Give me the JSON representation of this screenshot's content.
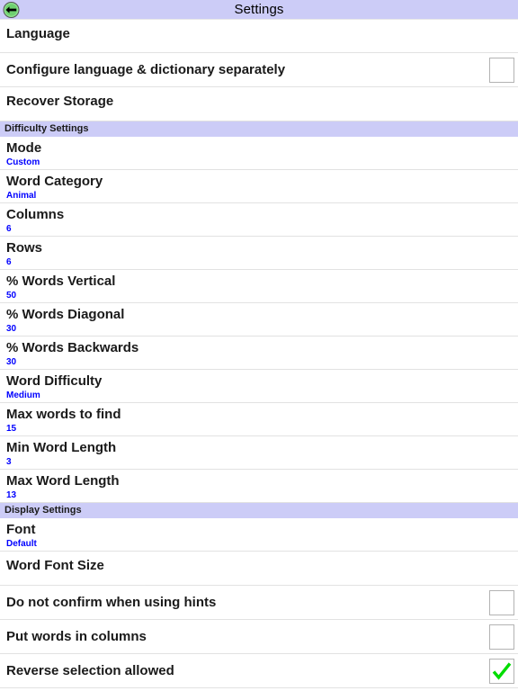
{
  "titlebar": {
    "title": "Settings",
    "back_icon": "back-arrow-icon",
    "background_color": "#CCCCF7",
    "back_circle_color": "#8CE08C",
    "back_arrow_color": "#000000"
  },
  "theme": {
    "row_background": "#FFFFFF",
    "divider_color": "#E2E2E2",
    "section_header_background": "#CCCCF7",
    "title_text_color": "#1A1A1A",
    "value_text_color": "#0000FF",
    "checkbox_border_color": "#B3B3B3",
    "check_color": "#00DD00"
  },
  "sections": [
    {
      "header": null,
      "rows": [
        {
          "name": "language",
          "title": "Language",
          "value": null,
          "type": "nav"
        },
        {
          "name": "configure-separately",
          "title": "Configure language & dictionary separately",
          "value": null,
          "type": "checkbox",
          "checked": false
        },
        {
          "name": "recover-storage",
          "title": "Recover Storage",
          "value": null,
          "type": "nav"
        }
      ]
    },
    {
      "header": "Difficulty Settings",
      "rows": [
        {
          "name": "mode",
          "title": "Mode",
          "value": "Custom",
          "type": "value"
        },
        {
          "name": "word-category",
          "title": "Word Category",
          "value": "Animal",
          "type": "value"
        },
        {
          "name": "columns",
          "title": "Columns",
          "value": "6",
          "type": "value"
        },
        {
          "name": "rows",
          "title": "Rows",
          "value": "6",
          "type": "value"
        },
        {
          "name": "pct-words-vertical",
          "title": "% Words Vertical",
          "value": "50",
          "type": "value"
        },
        {
          "name": "pct-words-diagonal",
          "title": "% Words Diagonal",
          "value": "30",
          "type": "value"
        },
        {
          "name": "pct-words-backwards",
          "title": "% Words Backwards",
          "value": "30",
          "type": "value"
        },
        {
          "name": "word-difficulty",
          "title": "Word Difficulty",
          "value": "Medium",
          "type": "value"
        },
        {
          "name": "max-words-to-find",
          "title": "Max words to find",
          "value": "15",
          "type": "value"
        },
        {
          "name": "min-word-length",
          "title": "Min Word Length",
          "value": "3",
          "type": "value"
        },
        {
          "name": "max-word-length",
          "title": "Max Word Length",
          "value": "13",
          "type": "value"
        }
      ]
    },
    {
      "header": "Display Settings",
      "rows": [
        {
          "name": "font",
          "title": "Font",
          "value": "Default",
          "type": "value"
        },
        {
          "name": "word-font-size",
          "title": "Word Font Size",
          "value": null,
          "type": "nav"
        },
        {
          "name": "no-confirm-hints",
          "title": "Do not confirm when using hints",
          "value": null,
          "type": "checkbox",
          "checked": false
        },
        {
          "name": "put-words-in-columns",
          "title": "Put words in columns",
          "value": null,
          "type": "checkbox",
          "checked": false
        },
        {
          "name": "reverse-selection",
          "title": "Reverse selection allowed",
          "value": null,
          "type": "checkbox",
          "checked": true
        }
      ]
    }
  ]
}
